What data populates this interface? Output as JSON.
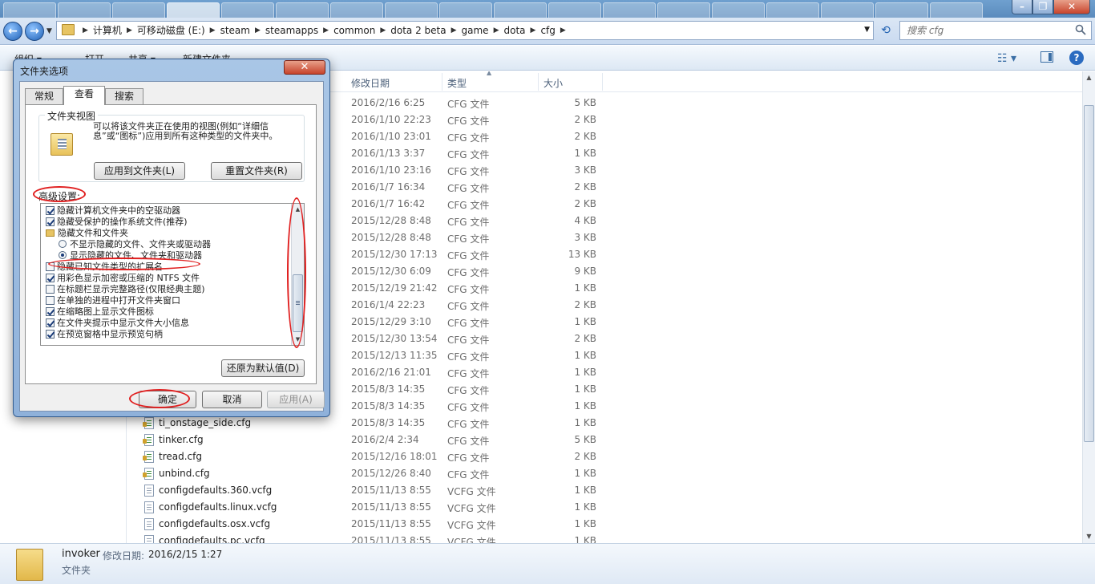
{
  "explorer": {
    "address": {
      "crumbs": [
        "计算机",
        "可移动磁盘 (E:)",
        "steam",
        "steamapps",
        "common",
        "dota 2 beta",
        "game",
        "dota",
        "cfg"
      ]
    },
    "search": {
      "placeholder": "搜索 cfg"
    },
    "toolbar": {
      "organize": "组织 ▾",
      "open": "打开",
      "share": "共享 ▾",
      "new_folder": "新建文件夹"
    },
    "columns": {
      "modified": "修改日期",
      "type": "类型",
      "size": "大小"
    },
    "rows": [
      {
        "name": "",
        "date": "2016/2/16 6:25",
        "type": "CFG 文件",
        "size": "5 KB",
        "icon": "cfg"
      },
      {
        "name": "",
        "date": "2016/1/10 22:23",
        "type": "CFG 文件",
        "size": "2 KB",
        "icon": "cfg"
      },
      {
        "name": "",
        "date": "2016/1/10 23:01",
        "type": "CFG 文件",
        "size": "2 KB",
        "icon": "cfg"
      },
      {
        "name": "",
        "date": "2016/1/13 3:37",
        "type": "CFG 文件",
        "size": "1 KB",
        "icon": "cfg"
      },
      {
        "name": "",
        "date": "2016/1/10 23:16",
        "type": "CFG 文件",
        "size": "3 KB",
        "icon": "cfg"
      },
      {
        "name": "",
        "date": "2016/1/7 16:34",
        "type": "CFG 文件",
        "size": "2 KB",
        "icon": "cfg"
      },
      {
        "name": "",
        "date": "2016/1/7 16:42",
        "type": "CFG 文件",
        "size": "2 KB",
        "icon": "cfg"
      },
      {
        "name": "",
        "date": "2015/12/28 8:48",
        "type": "CFG 文件",
        "size": "4 KB",
        "icon": "cfg"
      },
      {
        "name": "",
        "date": "2015/12/28 8:48",
        "type": "CFG 文件",
        "size": "3 KB",
        "icon": "cfg"
      },
      {
        "name": "",
        "date": "2015/12/30 17:13",
        "type": "CFG 文件",
        "size": "13 KB",
        "icon": "cfg"
      },
      {
        "name": "",
        "date": "2015/12/30 6:09",
        "type": "CFG 文件",
        "size": "9 KB",
        "icon": "cfg"
      },
      {
        "name": "",
        "date": "2015/12/19 21:42",
        "type": "CFG 文件",
        "size": "1 KB",
        "icon": "cfg"
      },
      {
        "name": "",
        "date": "2016/1/4 22:23",
        "type": "CFG 文件",
        "size": "2 KB",
        "icon": "cfg"
      },
      {
        "name": "",
        "date": "2015/12/29 3:10",
        "type": "CFG 文件",
        "size": "1 KB",
        "icon": "cfg"
      },
      {
        "name": "",
        "date": "2015/12/30 13:54",
        "type": "CFG 文件",
        "size": "2 KB",
        "icon": "cfg"
      },
      {
        "name": "",
        "date": "2015/12/13 11:35",
        "type": "CFG 文件",
        "size": "1 KB",
        "icon": "cfg"
      },
      {
        "name": "",
        "date": "2016/2/16 21:01",
        "type": "CFG 文件",
        "size": "1 KB",
        "icon": "cfg"
      },
      {
        "name": "",
        "date": "2015/8/3 14:35",
        "type": "CFG 文件",
        "size": "1 KB",
        "icon": "cfg"
      },
      {
        "name": "",
        "date": "2015/8/3 14:35",
        "type": "CFG 文件",
        "size": "1 KB",
        "icon": "cfg"
      },
      {
        "name": "ti_onstage_side.cfg",
        "date": "2015/8/3 14:35",
        "type": "CFG 文件",
        "size": "1 KB",
        "icon": "cfg"
      },
      {
        "name": "tinker.cfg",
        "date": "2016/2/4 2:34",
        "type": "CFG 文件",
        "size": "5 KB",
        "icon": "cfg"
      },
      {
        "name": "tread.cfg",
        "date": "2015/12/16 18:01",
        "type": "CFG 文件",
        "size": "2 KB",
        "icon": "cfg"
      },
      {
        "name": "unbind.cfg",
        "date": "2015/12/26 8:40",
        "type": "CFG 文件",
        "size": "1 KB",
        "icon": "cfg"
      },
      {
        "name": "configdefaults.360.vcfg",
        "date": "2015/11/13 8:55",
        "type": "VCFG 文件",
        "size": "1 KB",
        "icon": "vcfg"
      },
      {
        "name": "configdefaults.linux.vcfg",
        "date": "2015/11/13 8:55",
        "type": "VCFG 文件",
        "size": "1 KB",
        "icon": "vcfg"
      },
      {
        "name": "configdefaults.osx.vcfg",
        "date": "2015/11/13 8:55",
        "type": "VCFG 文件",
        "size": "1 KB",
        "icon": "vcfg"
      },
      {
        "name": "configdefaults.pc.vcfg",
        "date": "2015/11/13 8:55",
        "type": "VCFG 文件",
        "size": "1 KB",
        "icon": "vcfg"
      }
    ],
    "details": {
      "name": "invoker",
      "date_label": "修改日期:",
      "date": "2016/2/15 1:27",
      "type": "文件夹"
    }
  },
  "dialog": {
    "title": "文件夹选项",
    "close": "✕",
    "tabs": {
      "general": "常规",
      "view": "查看",
      "search": "搜索"
    },
    "folder_views": {
      "title": "文件夹视图",
      "description": "可以将该文件夹正在使用的视图(例如“详细信息”或“图标”)应用到所有这种类型的文件夹中。",
      "apply_button": "应用到文件夹(L)",
      "reset_button": "重置文件夹(R)"
    },
    "advanced_label": "高级设置:",
    "advanced_items": [
      {
        "label": "隐藏计算机文件夹中的空驱动器",
        "kind": "check",
        "checked": true,
        "indent": 0
      },
      {
        "label": "隐藏受保护的操作系统文件(推荐)",
        "kind": "check",
        "checked": true,
        "indent": 0
      },
      {
        "label": "隐藏文件和文件夹",
        "kind": "folder",
        "checked": false,
        "indent": 0
      },
      {
        "label": "不显示隐藏的文件、文件夹或驱动器",
        "kind": "radio",
        "checked": false,
        "indent": 1
      },
      {
        "label": "显示隐藏的文件、文件夹和驱动器",
        "kind": "radio",
        "checked": true,
        "indent": 1
      },
      {
        "label": "隐藏已知文件类型的扩展名",
        "kind": "check",
        "checked": false,
        "indent": 0
      },
      {
        "label": "用彩色显示加密或压缩的 NTFS 文件",
        "kind": "check",
        "checked": true,
        "indent": 0
      },
      {
        "label": "在标题栏显示完整路径(仅限经典主题)",
        "kind": "check",
        "checked": false,
        "indent": 0
      },
      {
        "label": "在单独的进程中打开文件夹窗口",
        "kind": "check",
        "checked": false,
        "indent": 0
      },
      {
        "label": "在缩略图上显示文件图标",
        "kind": "check",
        "checked": true,
        "indent": 0
      },
      {
        "label": "在文件夹提示中显示文件大小信息",
        "kind": "check",
        "checked": true,
        "indent": 0
      },
      {
        "label": "在预览窗格中显示预览句柄",
        "kind": "check",
        "checked": true,
        "indent": 0
      }
    ],
    "restore_button": "还原为默认值(D)",
    "ok": "确定",
    "cancel": "取消",
    "apply": "应用(A)"
  },
  "colors": {
    "annotation_red": "#e02020",
    "title_blue": "#5b8bbd",
    "close_red": "#c7432b"
  }
}
